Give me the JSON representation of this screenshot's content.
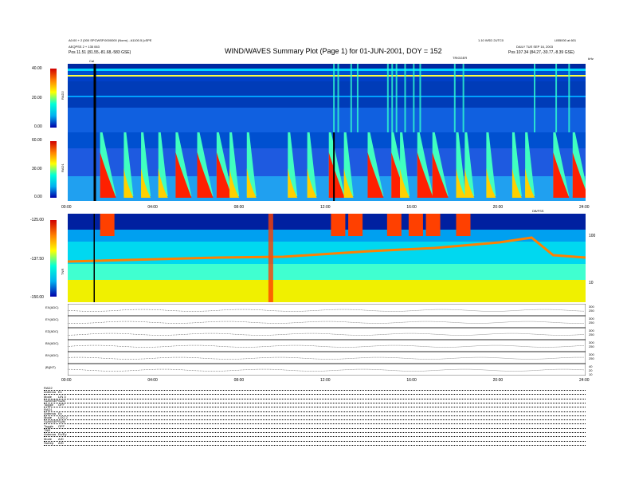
{
  "header": {
    "title": "WIND/WAVES Summary Plot (Page 1) for 01-JUN-2001, DOY = 152",
    "left_line1": "A0:00 + 2 [000 SPCWSP.0000000 (Norm) - A1100.5 [cSPE",
    "left_line2": "AEQPSS 2 + 135 063",
    "left_pos": "Pos   11.51 (81.55,-81.68,-583 GSE)",
    "right_line1": "1.10 WSD 2UTC0",
    "right_line1b": "LIB5000 at 601",
    "right_line2": "DAILY   TUE SEP 16, 2003",
    "right_pos": "Pos   107.34 (84.27,-30.77,-8.39 GSE)",
    "sub_label": "TRIGGER",
    "corner_unit": "kHz",
    "cal_label": "Cal",
    "dbfss_label": "DB/FSS"
  },
  "colors": {
    "background_min": "#0000a8",
    "low": "#00b0f0",
    "mid": "#00ffd8",
    "high": "#ffff00",
    "max": "#d00000"
  },
  "chart_data": [
    {
      "type": "heatmap",
      "name": "RAD2",
      "colorbar_ticks": [
        "40.00",
        "20.00",
        "0.00"
      ],
      "xlim": [
        0,
        24
      ],
      "x_tick_labels": [
        "00:00",
        "04:00",
        "08:00",
        "12:00",
        "16:00",
        "20:00",
        "24:00"
      ]
    },
    {
      "type": "heatmap",
      "name": "RAD1",
      "colorbar_ticks": [
        "60.00",
        "30.00",
        "0.00"
      ],
      "bursts_hours": [
        1.5,
        2.6,
        3.4,
        4.2,
        5.0,
        6.0,
        6.9,
        7.5,
        8.3,
        10.2,
        11.1,
        12.1,
        12.8,
        13.9,
        15.0,
        15.4,
        16.2,
        16.9,
        18.0,
        18.4,
        19.4,
        20.6,
        21.2,
        22.5,
        23.4
      ]
    },
    {
      "type": "heatmap",
      "name": "TNR",
      "colorbar_ticks": [
        "-125.00",
        "-137.50",
        "-150.00"
      ],
      "right_ticks": [
        "100",
        "10"
      ]
    },
    {
      "type": "line",
      "rows": [
        {
          "label": "EX(ADC)",
          "right_ticks": [
            "300",
            "250"
          ]
        },
        {
          "label": "EY(ADC)",
          "right_ticks": [
            "300",
            "250"
          ]
        },
        {
          "label": "EZ(ADC)",
          "right_ticks": [
            "300",
            "250"
          ]
        },
        {
          "label": "BX(ADC)",
          "right_ticks": [
            "300",
            "250"
          ]
        },
        {
          "label": "BY(ADC)",
          "right_ticks": [
            "300",
            "250"
          ]
        },
        {
          "label": "|B|(NT)",
          "right_ticks": [
            "40",
            "20",
            "10"
          ]
        }
      ],
      "x_tick_labels": [
        "00:00",
        "04:00",
        "08:00",
        "12:00",
        "16:00",
        "20:00",
        "24:00"
      ]
    }
  ],
  "footer": {
    "rows": [
      {
        "key": "RAD2",
        "val": ""
      },
      {
        "key": "Antenna",
        "val": "Ex"
      },
      {
        "key": "Mode",
        "val": "LIN 3"
      },
      {
        "key": "SUM/SEP",
        "val": "SUM"
      },
      {
        "key": "Toggle",
        "val": "OFF"
      },
      {
        "key": "RAD1",
        "val": ""
      },
      {
        "key": "Antenna",
        "val": "Ex"
      },
      {
        "key": "Mode",
        "val": "LOG 2"
      },
      {
        "key": "SUM/SEP",
        "val": "SUM"
      },
      {
        "key": "Toggle",
        "val": "OFF"
      },
      {
        "key": "TNR",
        "val": ""
      },
      {
        "key": "Antenna",
        "val": "Ex/Ey"
      },
      {
        "key": "Mode",
        "val": "A/D"
      },
      {
        "key": "Sweep",
        "val": "A/D"
      }
    ]
  }
}
